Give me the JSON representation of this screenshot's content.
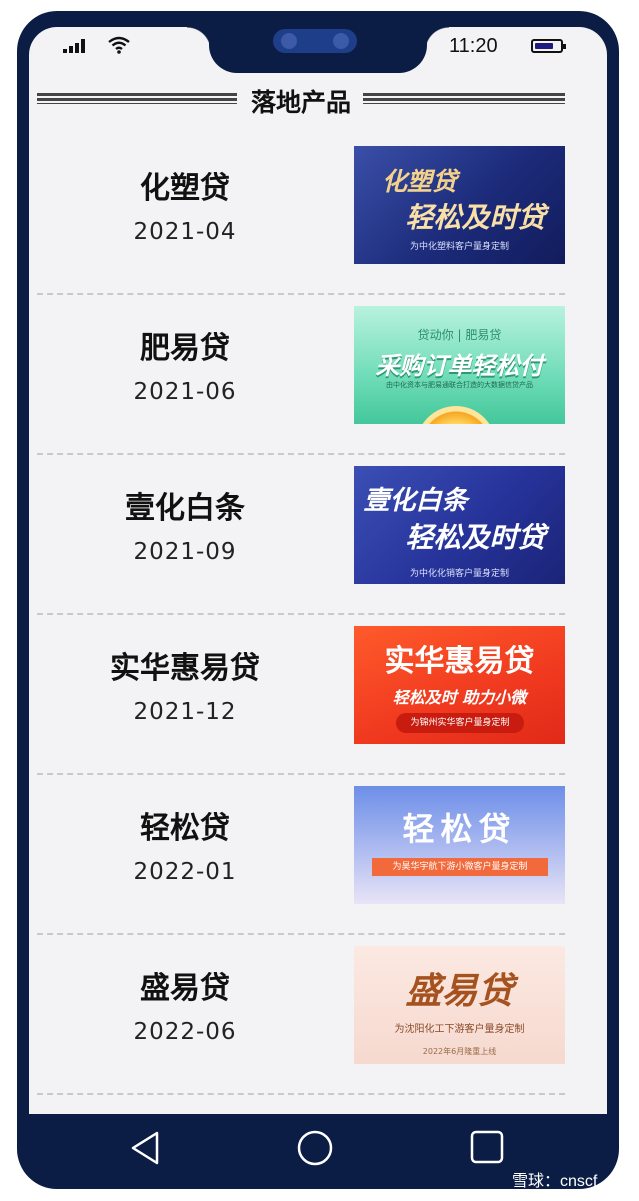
{
  "status_bar": {
    "time": "11:20"
  },
  "section": {
    "title": "落地产品"
  },
  "products": [
    {
      "name": "化塑贷",
      "date": "2021-04",
      "banner": {
        "title_line1": "化塑贷",
        "title_line2": "轻松及时贷",
        "subtitle": "为中化塑料客户量身定制"
      }
    },
    {
      "name": "肥易贷",
      "date": "2021-06",
      "banner": {
        "top_line": "贷动你 | 肥易贷",
        "title": "采购订单轻松付",
        "subtitle": "由中化资本与肥易通联合打造的大数据信贷产品"
      }
    },
    {
      "name": "壹化白条",
      "date": "2021-09",
      "banner": {
        "title_line1": "壹化白条",
        "title_line2": "轻松及时贷",
        "subtitle": "为中化化销客户量身定制"
      }
    },
    {
      "name": "实华惠易贷",
      "date": "2021-12",
      "banner": {
        "title": "实华惠易贷",
        "slogan": "轻松及时 助力小微",
        "subtitle": "为锦州实华客户量身定制"
      }
    },
    {
      "name": "轻松贷",
      "date": "2022-01",
      "banner": {
        "title": "轻松贷",
        "subtitle": "为昊华宇航下游小微客户量身定制"
      }
    },
    {
      "name": "盛易贷",
      "date": "2022-06",
      "banner": {
        "title": "盛易贷",
        "subtitle": "为沈阳化工下游客户量身定制",
        "note": "2022年6月隆重上线"
      }
    }
  ],
  "watermark": "雪球：cnscf"
}
